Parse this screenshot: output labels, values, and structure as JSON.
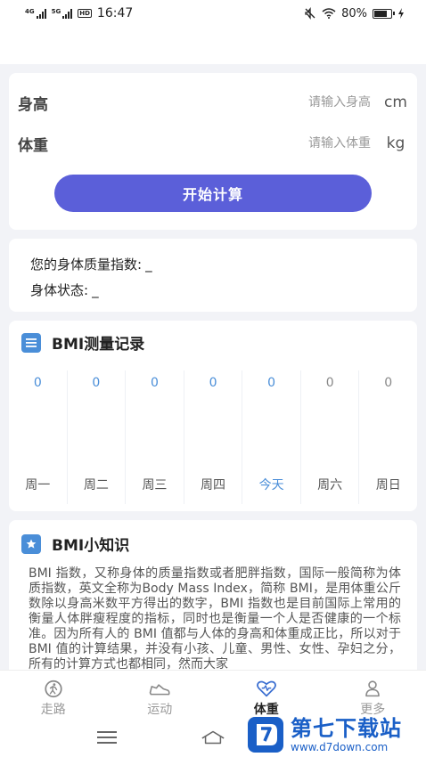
{
  "status_bar": {
    "sig1": "4G",
    "sig2": "5G",
    "hd": "HD",
    "time": "16:47",
    "battery": "80%",
    "battery_level": 0.8
  },
  "form": {
    "height_label": "身高",
    "height_placeholder": "请输入身高",
    "height_unit": "cm",
    "weight_label": "体重",
    "weight_placeholder": "请输入体重",
    "weight_unit": "kg",
    "calc_button": "开始计算"
  },
  "result": {
    "bmi_label": "您的身体质量指数:",
    "bmi_value": "_",
    "status_label": "身体状态:",
    "status_value": "_"
  },
  "records": {
    "title": "BMI测量记录",
    "days": [
      {
        "value": "0",
        "name": "周一"
      },
      {
        "value": "0",
        "name": "周二"
      },
      {
        "value": "0",
        "name": "周三"
      },
      {
        "value": "0",
        "name": "周四"
      },
      {
        "value": "0",
        "name": "今天"
      },
      {
        "value": "0",
        "name": "周六"
      },
      {
        "value": "0",
        "name": "周日"
      }
    ],
    "accent": "#4a8ed8"
  },
  "knowledge": {
    "title": "BMI小知识",
    "text": "BMI 指数，又称身体的质量指数或者肥胖指数，国际一般简称为体质指数，英文全称为Body Mass Index，简称 BMI，是用体重公斤数除以身高米数平方得出的数字，BMI 指数也是目前国际上常用的衡量人体胖瘦程度的指标，同时也是衡量一个人是否健康的一个标准。因为所有人的 BMI 值都与人体的身高和体重成正比，所以对于 BMI 值的计算结果，并没有小孩、儿童、男性、女性、孕妇之分，所有的计算方式也都相同，然而大家"
  },
  "tabbar": {
    "tabs": [
      {
        "label": "走路",
        "icon": "walking-icon"
      },
      {
        "label": "运动",
        "icon": "sneaker-icon"
      },
      {
        "label": "体重",
        "icon": "heart-icon"
      },
      {
        "label": "更多",
        "icon": "person-icon"
      }
    ],
    "active_index": 2
  },
  "watermark": {
    "cn": "第七下载站",
    "url": "www.d7down.com"
  },
  "colors": {
    "button": "#5b5fd9",
    "accent_blue": "#4a8ed8",
    "background": "#f2f3f7"
  }
}
